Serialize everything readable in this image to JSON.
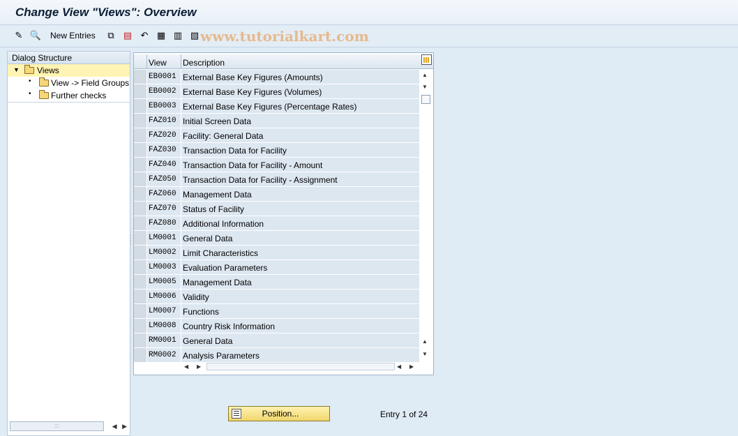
{
  "title": "Change View \"Views\": Overview",
  "toolbar": {
    "new_entries_label": "New Entries",
    "watermark": "www.tutorialkart.com",
    "icons": [
      "change-display-icon",
      "details-icon",
      "copy-icon",
      "delete-icon",
      "undo-icon",
      "select-all-icon",
      "select-block-icon",
      "deselect-all-icon"
    ]
  },
  "dialog": {
    "header": "Dialog Structure",
    "items": [
      {
        "label": "Views",
        "selected": true,
        "expanded": true
      },
      {
        "label": "View -> Field Groups"
      },
      {
        "label": "Further checks"
      }
    ]
  },
  "grid": {
    "columns": [
      "View",
      "Description"
    ],
    "rows": [
      {
        "view": "EB0001",
        "desc": "External Base Key Figures (Amounts)"
      },
      {
        "view": "EB0002",
        "desc": "External Base Key Figures (Volumes)"
      },
      {
        "view": "EB0003",
        "desc": "External Base Key Figures (Percentage Rates)"
      },
      {
        "view": "FAZ010",
        "desc": "Initial Screen Data"
      },
      {
        "view": "FAZ020",
        "desc": "Facility: General Data"
      },
      {
        "view": "FAZ030",
        "desc": "Transaction Data for Facility"
      },
      {
        "view": "FAZ040",
        "desc": "Transaction Data for Facility - Amount"
      },
      {
        "view": "FAZ050",
        "desc": "Transaction Data for Facility - Assignment"
      },
      {
        "view": "FAZ060",
        "desc": "Management Data"
      },
      {
        "view": "FAZ070",
        "desc": "Status of Facility"
      },
      {
        "view": "FAZ080",
        "desc": "Additional Information"
      },
      {
        "view": "LM0001",
        "desc": "General Data"
      },
      {
        "view": "LM0002",
        "desc": "Limit Characteristics"
      },
      {
        "view": "LM0003",
        "desc": "Evaluation Parameters"
      },
      {
        "view": "LM0005",
        "desc": "Management Data"
      },
      {
        "view": "LM0006",
        "desc": "Validity"
      },
      {
        "view": "LM0007",
        "desc": "Functions"
      },
      {
        "view": "LM0008",
        "desc": "Country Risk Information"
      },
      {
        "view": "RM0001",
        "desc": "General Data"
      },
      {
        "view": "RM0002",
        "desc": "Analysis Parameters"
      }
    ]
  },
  "footer": {
    "position_label": "Position...",
    "entry_info": "Entry 1 of 24"
  }
}
